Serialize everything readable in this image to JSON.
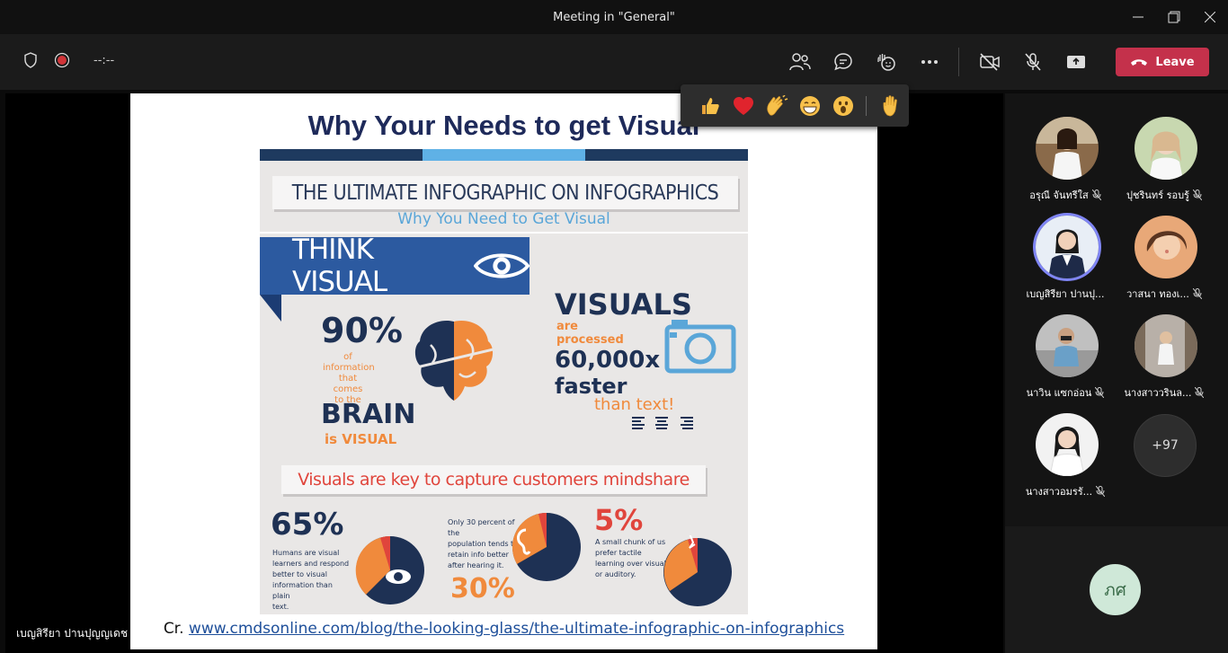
{
  "window": {
    "title": "Meeting in \"General\""
  },
  "toolbar": {
    "timer": "--:--",
    "leave_label": "Leave"
  },
  "slide": {
    "title": "Why Your Needs to get Visual",
    "credit_prefix": "Cr.",
    "credit_link": "www.cmdsonline.com/blog/the-looking-glass/the-ultimate-infographic-on-infographics",
    "infographic": {
      "banner": "THE ULTIMATE INFOGRAPHIC ON INFOGRAPHICS",
      "subtitle": "Why You Need to Get Visual",
      "think": "THINK VISUAL",
      "pct90": "90%",
      "of_info_1": "of",
      "of_info_2": "information",
      "of_info_3": "that comes",
      "of_info_4": "to the",
      "brain": "BRAIN",
      "is_visual": "is VISUAL",
      "visuals": "VISUALS",
      "are": "are",
      "processed": "processed",
      "times": "60,000x",
      "faster": "faster",
      "than_text": "than text!",
      "mindshare": "Visuals are key to capture customers mindshare",
      "pct65": "65%",
      "text65_1": "Humans are visual",
      "text65_2": "learners and respond",
      "text65_3": "better to visual",
      "text65_4": "information than plain",
      "text65_5": "text.",
      "text30_1": "Only 30 percent of the",
      "text30_2": "population tends to",
      "text30_3": "retain info better",
      "text30_4": "after hearing it.",
      "pct30": "30%",
      "pct5": "5%",
      "text5_1": "A small chunk of us",
      "text5_2": "prefer tactile",
      "text5_3": "learning over visual",
      "text5_4": "or auditory."
    }
  },
  "presenter_name": "เบญสิรียา ปานปุญญเดช",
  "participants": [
    {
      "name": "อรุณี จันทรีใส"
    },
    {
      "name": "ปุชรินทร์ รอบรู้"
    },
    {
      "name": "เบญสิรียา ปานปุ..."
    },
    {
      "name": "วาสนา ทองเ..."
    },
    {
      "name": "นาวิน แซกอ่อน"
    },
    {
      "name": "นางสาววรินล..."
    },
    {
      "name": "นางสาวอมรรั..."
    }
  ],
  "more_count": "+97",
  "self_initials": "ภศ",
  "colors": {
    "leave": "#c4314b",
    "active_ring": "#7f85f5",
    "navy": "#1e3154",
    "orange": "#f08a3c"
  }
}
